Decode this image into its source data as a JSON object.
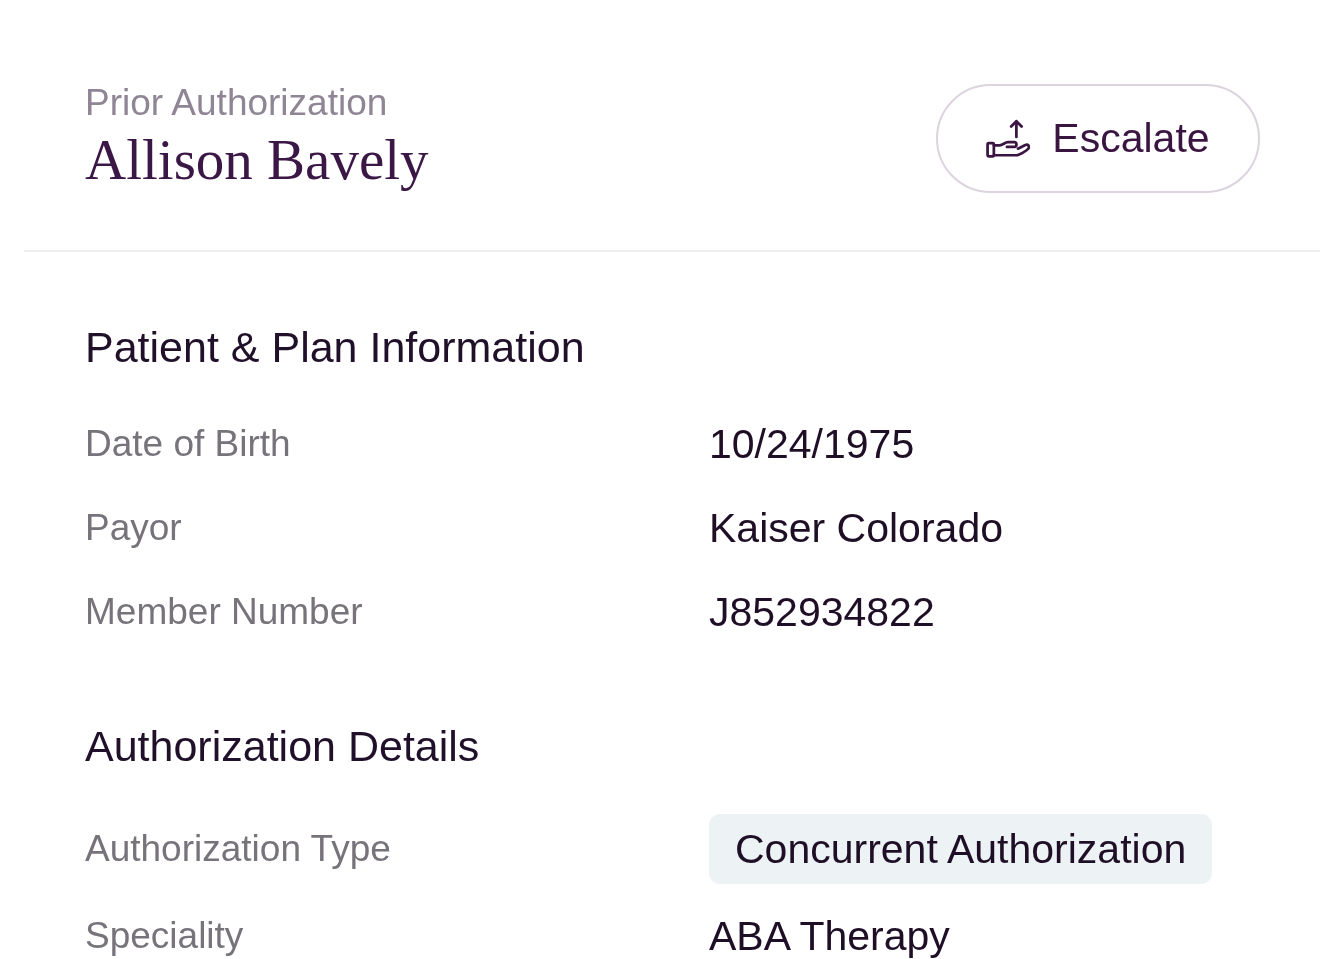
{
  "header": {
    "eyebrow": "Prior Authorization",
    "title": "Allison Bavely",
    "action": {
      "label": "Escalate"
    }
  },
  "sections": [
    {
      "title": "Patient & Plan Information",
      "fields": [
        {
          "label": "Date of Birth",
          "value": "10/24/1975",
          "kind": "text"
        },
        {
          "label": "Payor",
          "value": "Kaiser Colorado",
          "kind": "text"
        },
        {
          "label": "Member Number",
          "value": "J852934822",
          "kind": "text"
        }
      ]
    },
    {
      "title": "Authorization Details",
      "fields": [
        {
          "label": "Authorization Type",
          "value": "Concurrent Authorization",
          "kind": "tag"
        },
        {
          "label": "Speciality",
          "value": "ABA Therapy",
          "kind": "text"
        }
      ]
    }
  ]
}
